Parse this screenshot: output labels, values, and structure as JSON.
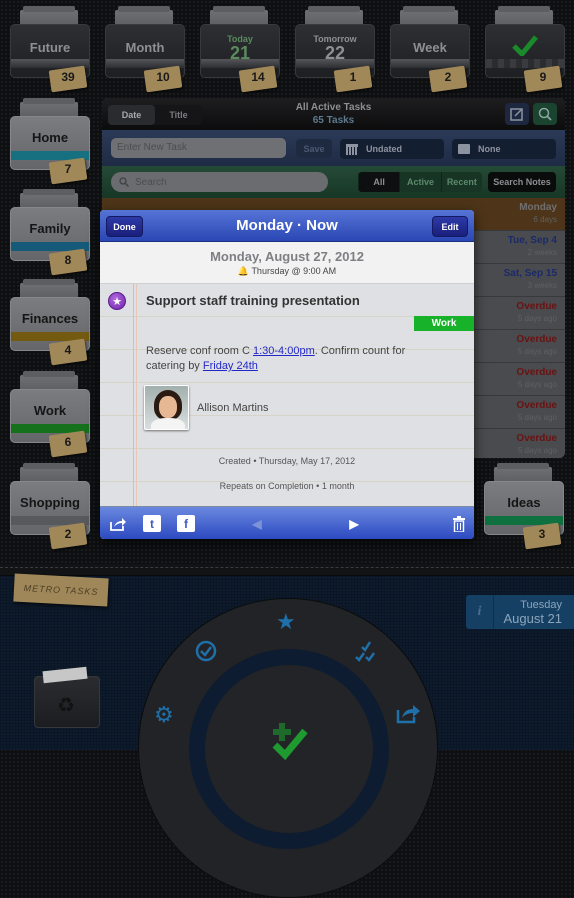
{
  "top_folders": [
    {
      "label": "Future",
      "count": "39"
    },
    {
      "label": "Month",
      "count": "10"
    },
    {
      "sub": "Today",
      "big": "21",
      "count": "14"
    },
    {
      "sub": "Tomorrow",
      "big": "22",
      "count": "1"
    },
    {
      "label": "Week",
      "count": "2"
    },
    {
      "icon": "checkmark-icon",
      "count": "9"
    }
  ],
  "side_folders": [
    {
      "label": "Home",
      "count": "7",
      "color": "#1a8aa0"
    },
    {
      "label": "Family",
      "count": "8",
      "color": "#1a6e94"
    },
    {
      "label": "Finances",
      "count": "4",
      "color": "#8e6d12"
    },
    {
      "label": "Work",
      "count": "6",
      "color": "#1a8a22"
    },
    {
      "label": "Shopping",
      "count": "2",
      "color": "#6a6b6e"
    }
  ],
  "right_folder": {
    "label": "Ideas",
    "count": "3",
    "color": "#128a4a"
  },
  "panel": {
    "sort": {
      "date": "Date",
      "title": "Title"
    },
    "title": "All Active Tasks",
    "subtitle": "65 Tasks",
    "new_task_placeholder": "Enter New Task",
    "save": "Save",
    "date_dropdown": "Undated",
    "folder_dropdown": "None",
    "search_placeholder": "Search",
    "filters": [
      "All",
      "Active",
      "Recent"
    ],
    "search_notes": "Search Notes",
    "tasks": [
      {
        "due": "Monday",
        "ago": "6 days",
        "color": "#6f6f72"
      },
      {
        "due": "Tue, Sep 4",
        "ago": "2 weeks",
        "color": "#1a2a6a"
      },
      {
        "due": "Sat, Sep 15",
        "ago": "3 weeks",
        "color": "#1a2a6a"
      },
      {
        "due": "Overdue",
        "ago": "5 days ago",
        "color": "#6a1212"
      },
      {
        "due": "Overdue",
        "ago": "5 days ago",
        "color": "#6a1212"
      },
      {
        "due": "Overdue",
        "ago": "5 days ago",
        "color": "#6a1212"
      },
      {
        "due": "Overdue",
        "ago": "5 days ago",
        "color": "#6a1212"
      },
      {
        "due": "Overdue",
        "ago": "5 days ago",
        "color": "#6a1212"
      }
    ]
  },
  "popover": {
    "done": "Done",
    "title": "Monday · Now",
    "edit": "Edit",
    "date": "Monday, August 27, 2012",
    "alarm": "Thursday @ 9:00 AM",
    "task_title": "Support staff training presentation",
    "folder_tag": "Work",
    "notes_pre": "Reserve conf room C ",
    "notes_link1": "1:30-4:00pm",
    "notes_mid": ". Confirm count for catering by ",
    "notes_link2": "Friday 24th",
    "contact": "Allison Martins",
    "created": "Created • Thursday, May 17, 2012",
    "repeats": "Repeats on Completion • 1 month"
  },
  "bottom": {
    "note": "METRO TASKS",
    "date_day": "Tuesday",
    "date_full": "August 21"
  }
}
